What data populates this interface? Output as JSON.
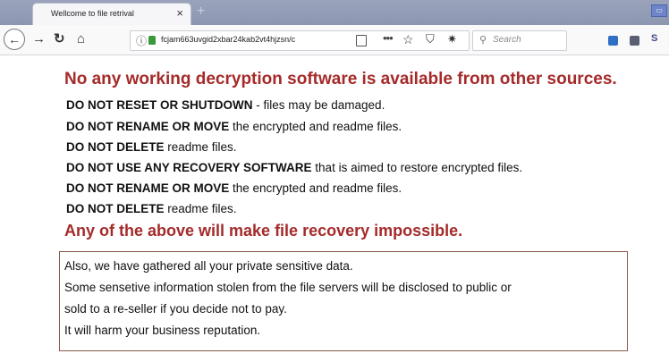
{
  "browser": {
    "tab_title": "Wellcome to file retrival",
    "tab_close": "×",
    "new_tab": "+",
    "url": "fcjam663uvgid2xbar24kab2vt4hjzsn/c",
    "search_placeholder": "Search",
    "icons": [
      "back-icon",
      "forward-icon",
      "reload-icon",
      "home-icon",
      "info-icon",
      "lock-icon",
      "reader-icon",
      "more-icon",
      "star-icon",
      "shield-icon",
      "extension-icon",
      "search-icon"
    ]
  },
  "page": {
    "headline": "No any working decryption software is available from other sources.",
    "warnings": [
      {
        "bold": "DO NOT RESET OR SHUTDOWN",
        "rest": " - files may be damaged."
      },
      {
        "bold": "DO NOT RENAME OR MOVE",
        "rest": " the encrypted and readme files."
      },
      {
        "bold": "DO NOT DELETE",
        "rest": " readme files."
      },
      {
        "bold": "DO NOT USE ANY RECOVERY SOFTWARE",
        "rest": " that is aimed to restore encrypted files."
      },
      {
        "bold": "DO NOT RENAME OR MOVE",
        "rest": " the encrypted and readme files."
      },
      {
        "bold": "DO NOT DELETE",
        "rest": " readme files."
      }
    ],
    "footline": "Any of the above will make file recovery impossible.",
    "notice_lines": [
      "Also, we have gathered all your private sensitive data.",
      "Some sensetive information stolen from the file servers will be disclosed to public or",
      "sold to a re-seller if you decide not to pay.",
      "It will harm your business reputation."
    ]
  },
  "colors": {
    "headline": "#a52a2a",
    "body_text": "#111111"
  }
}
